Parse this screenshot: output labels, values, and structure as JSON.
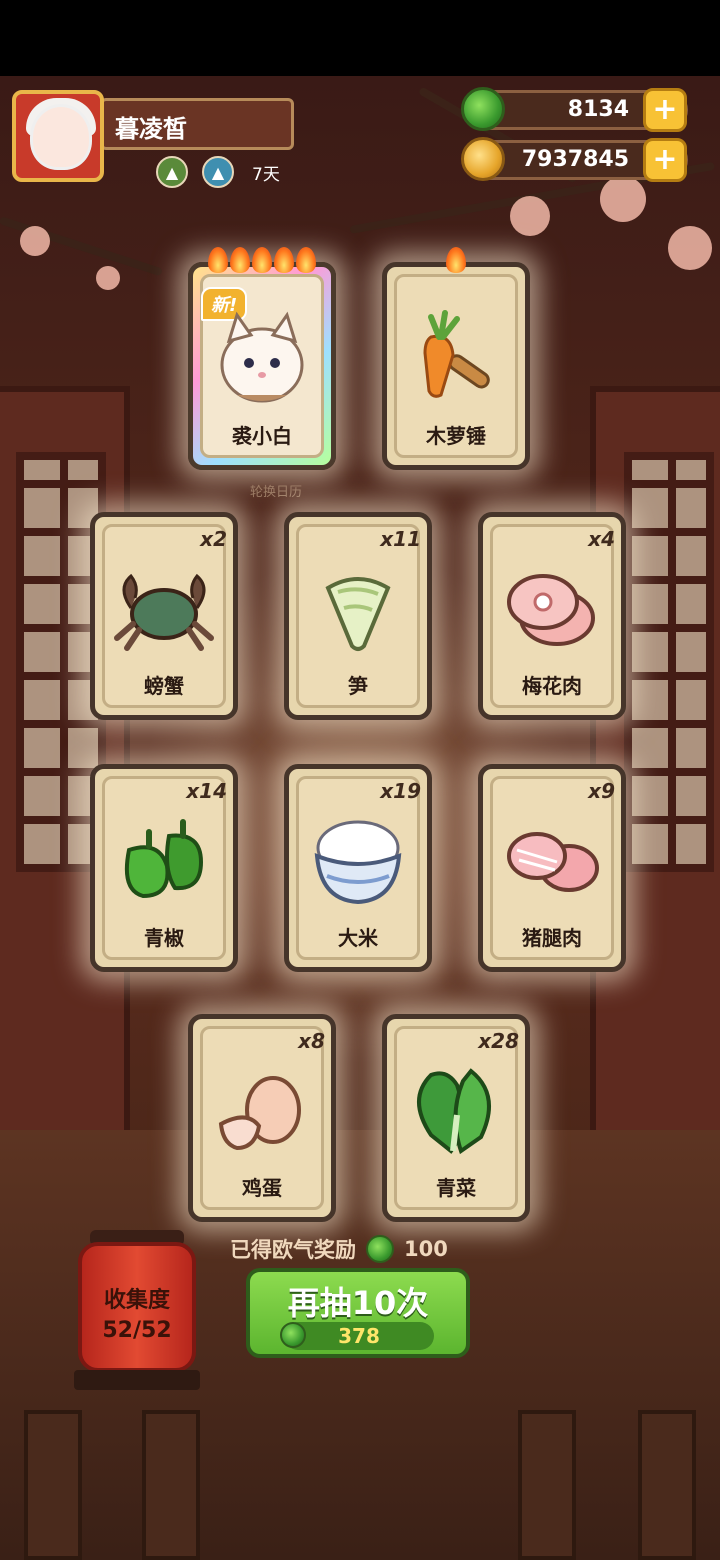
{
  "player": {
    "name": "暮凌皙",
    "buff_days": "7天"
  },
  "currency": {
    "jade": "8134",
    "coins": "7937845"
  },
  "featured": [
    {
      "label": "裘小白",
      "tag": "新!",
      "flames": 5
    },
    {
      "label": "木萝锤",
      "flames": 1
    }
  ],
  "rotate_calendar": "轮换日历",
  "items": [
    {
      "label": "螃蟹",
      "count": "x2"
    },
    {
      "label": "笋",
      "count": "x11"
    },
    {
      "label": "梅花肉",
      "count": "x4"
    },
    {
      "label": "青椒",
      "count": "x14"
    },
    {
      "label": "大米",
      "count": "x19"
    },
    {
      "label": "猪腿肉",
      "count": "x9"
    },
    {
      "label": "鸡蛋",
      "count": "x8"
    },
    {
      "label": "青菜",
      "count": "x28"
    }
  ],
  "reward": {
    "text": "已得欧气奖励",
    "amount": "100"
  },
  "draw_button": {
    "label": "再抽10次",
    "cost": "378"
  },
  "collection": {
    "title": "收集度",
    "progress": "52/52"
  },
  "colors": {
    "jade": "#3a9a2e",
    "gold": "#f8c235",
    "button_green": "#5cb52f",
    "lantern_red": "#c8301f"
  }
}
